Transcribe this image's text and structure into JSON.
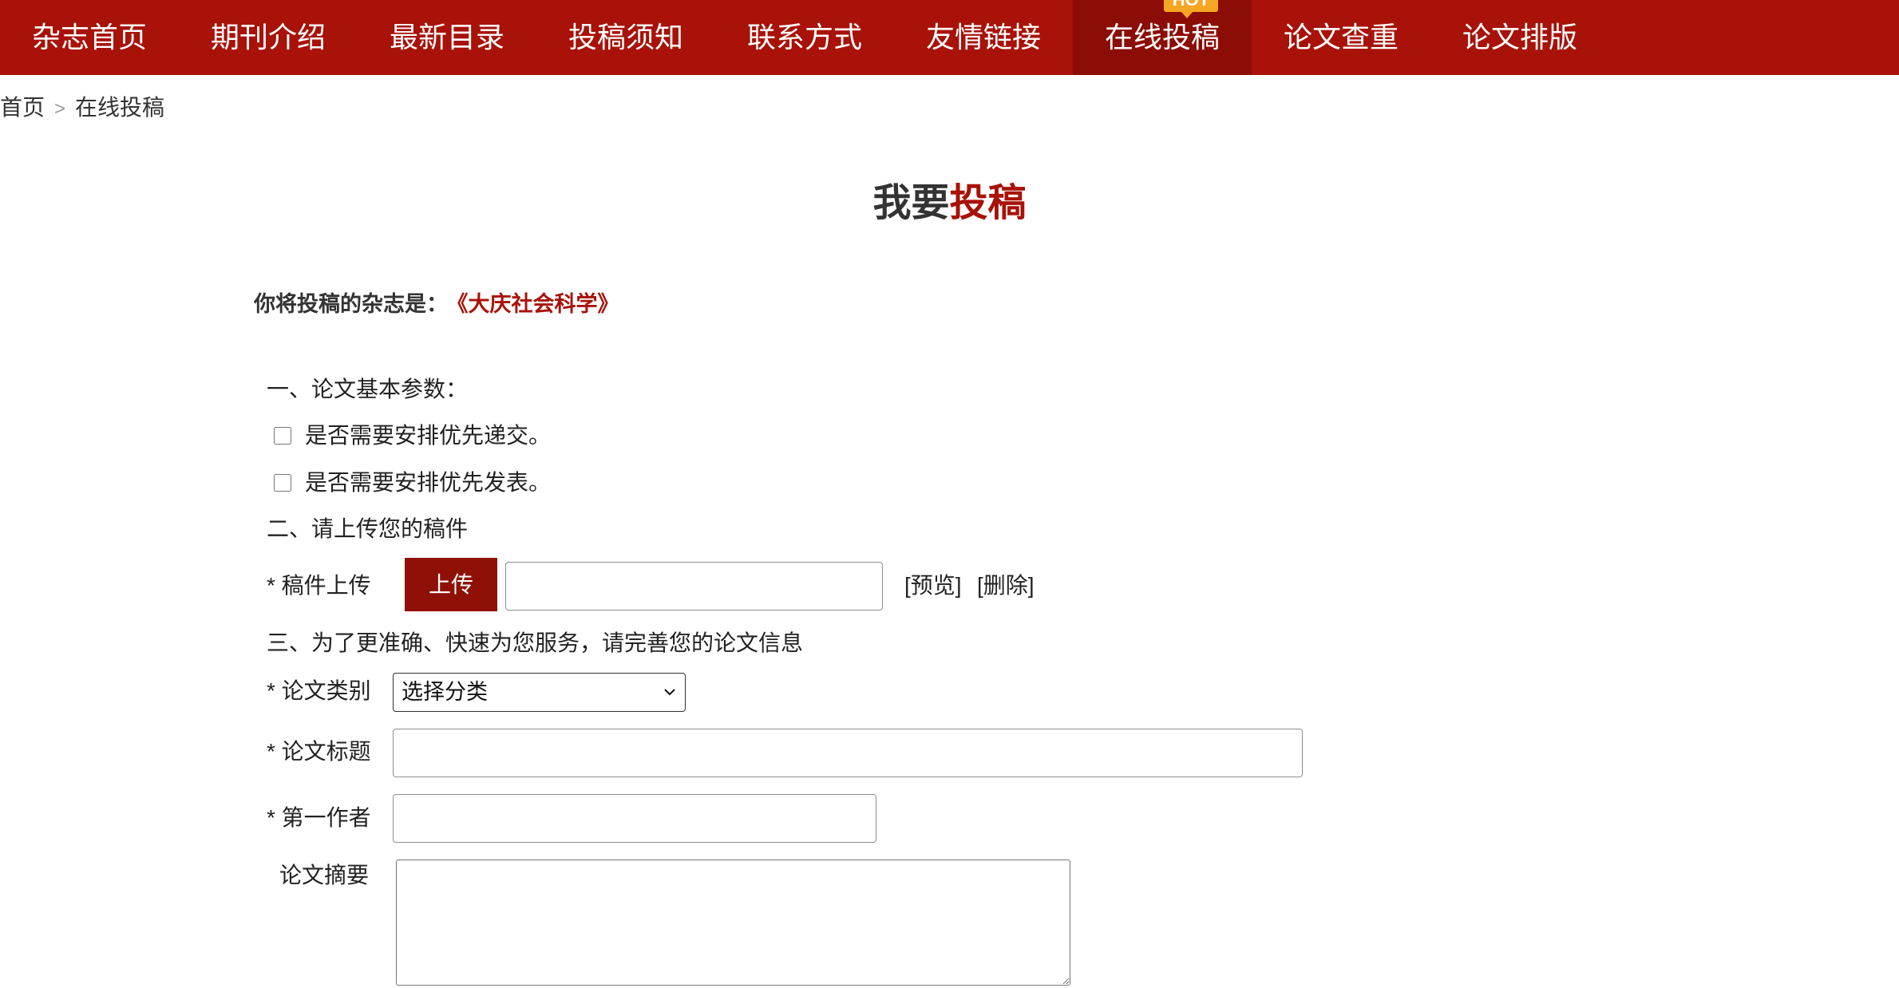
{
  "nav": {
    "items": [
      {
        "label": "杂志首页"
      },
      {
        "label": "期刊介绍"
      },
      {
        "label": "最新目录"
      },
      {
        "label": "投稿须知"
      },
      {
        "label": "联系方式"
      },
      {
        "label": "友情链接"
      },
      {
        "label": "在线投稿"
      },
      {
        "label": "论文查重"
      },
      {
        "label": "论文排版"
      }
    ],
    "hot_badge": "HOT"
  },
  "breadcrumb": {
    "home": "首页",
    "separator": ">",
    "current": "在线投稿"
  },
  "title": {
    "part1": "我要",
    "part2": "投稿"
  },
  "journal": {
    "prefix": "你将投稿的杂志是：",
    "name": "《大庆社会科学》"
  },
  "section1": {
    "heading": "一、论文基本参数：",
    "options": [
      {
        "label": "是否需要安排优先递交。",
        "checked": false
      },
      {
        "label": "是否需要安排优先发表。",
        "checked": false
      }
    ]
  },
  "section2": {
    "heading": "二、请上传您的稿件",
    "upload_label": "* 稿件上传",
    "upload_button": "上传",
    "preview_link": "[预览]",
    "delete_link": "[删除]"
  },
  "section3": {
    "heading": "三、为了更准确、快速为您服务，请完善您的论文信息",
    "category_label": "* 论文类别",
    "category_selected": "选择分类",
    "title_label": "* 论文标题",
    "author_label": "* 第一作者",
    "abstract_label": "论文摘要"
  },
  "colors": {
    "brand_red": "#a81208",
    "active_red": "#8c0d05",
    "button_red": "#8f1006",
    "badge_orange": "#f5a623"
  }
}
